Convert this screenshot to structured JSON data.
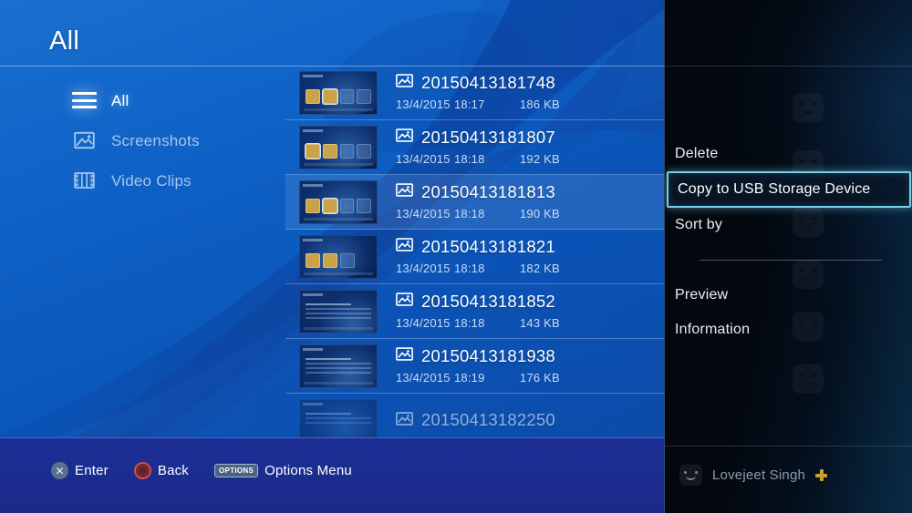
{
  "header": {
    "title": "All"
  },
  "sidebar": {
    "items": [
      {
        "label": "All",
        "icon": "hamburger-icon",
        "active": true
      },
      {
        "label": "Screenshots",
        "icon": "picture-icon",
        "active": false
      },
      {
        "label": "Video Clips",
        "icon": "film-strip-icon",
        "active": false
      }
    ]
  },
  "list": {
    "rows": [
      {
        "name": "20150413181748",
        "date": "13/4/2015",
        "time": "18:17",
        "size": "186 KB",
        "icon": "picture-icon",
        "selected": false
      },
      {
        "name": "20150413181807",
        "date": "13/4/2015",
        "time": "18:18",
        "size": "192 KB",
        "icon": "picture-icon",
        "selected": false
      },
      {
        "name": "20150413181813",
        "date": "13/4/2015",
        "time": "18:18",
        "size": "190 KB",
        "icon": "picture-icon",
        "selected": true
      },
      {
        "name": "20150413181821",
        "date": "13/4/2015",
        "time": "18:18",
        "size": "182 KB",
        "icon": "picture-icon",
        "selected": false
      },
      {
        "name": "20150413181852",
        "date": "13/4/2015",
        "time": "18:18",
        "size": "143 KB",
        "icon": "picture-icon",
        "selected": false
      },
      {
        "name": "20150413181938",
        "date": "13/4/2015",
        "time": "18:19",
        "size": "176 KB",
        "icon": "picture-icon",
        "selected": false
      },
      {
        "name": "20150413182250",
        "date": "",
        "time": "",
        "size": "",
        "icon": "picture-icon",
        "selected": false
      }
    ]
  },
  "options_menu": {
    "items": [
      {
        "label": "Delete",
        "highlighted": false
      },
      {
        "label": "Copy to USB Storage Device",
        "highlighted": true
      },
      {
        "label": "Sort by",
        "highlighted": false
      },
      {
        "label": "Preview",
        "highlighted": false
      },
      {
        "label": "Information",
        "highlighted": false
      }
    ],
    "highlight_color": "#76cfe9"
  },
  "user": {
    "name": "Lovejeet Singh",
    "badge": "ps-plus-badge",
    "avatar": "smiley-avatar-icon"
  },
  "footer": {
    "hints": [
      {
        "button": "cross-button",
        "glyph": "✕",
        "label": "Enter"
      },
      {
        "button": "circle-button",
        "glyph": "",
        "label": "Back"
      },
      {
        "button": "options-button",
        "glyph": "OPTIONS",
        "label": "Options Menu"
      }
    ]
  },
  "colors": {
    "background_blue": "#0a57bb",
    "panel_dark": "#03080f",
    "footer_navy": "#1b2c8e",
    "accent_cyan": "#76cfe9",
    "plus_gold": "#c9a227"
  }
}
